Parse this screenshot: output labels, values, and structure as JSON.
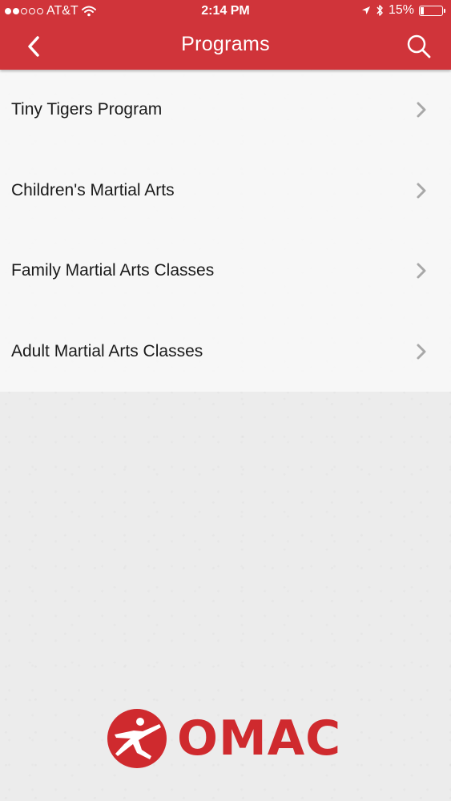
{
  "status_bar": {
    "carrier": "AT&T",
    "signal_bars_filled": 2,
    "signal_bars_total": 5,
    "time": "2:14 PM",
    "battery_percent": "15%",
    "battery_level": 0.15
  },
  "navbar": {
    "title": "Programs",
    "back_icon": "chevron-left-icon",
    "search_icon": "search-icon"
  },
  "programs": [
    {
      "label": "Tiny Tigers Program"
    },
    {
      "label": "Children's Martial Arts"
    },
    {
      "label": "Family Martial Arts Classes"
    },
    {
      "label": "Adult Martial Arts Classes"
    }
  ],
  "logo": {
    "text": "OMAC"
  },
  "colors": {
    "brand_red": "#d0343a",
    "logo_red": "#cf2a2e",
    "chevron_gray": "#a8a8a8",
    "list_background": "#f7f7f7",
    "page_background": "#ececec"
  }
}
